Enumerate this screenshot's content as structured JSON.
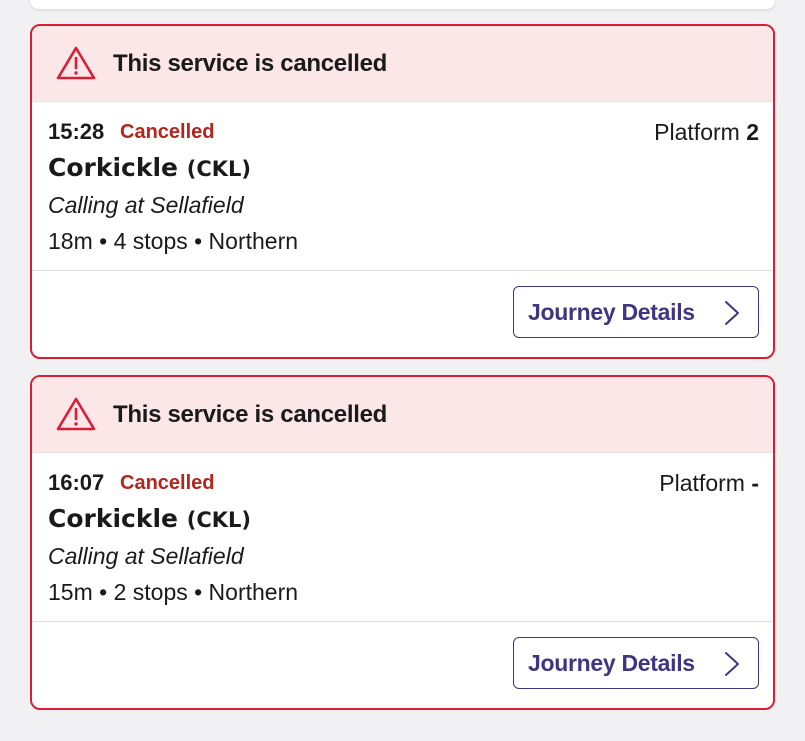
{
  "colors": {
    "alert_border": "#d81e34",
    "alert_bg": "#fce7e8",
    "status_red": "#b3261e",
    "button_accent": "#3f3580"
  },
  "services": [
    {
      "alert": "This service is cancelled",
      "time": "15:28",
      "status": "Cancelled",
      "platform_label": "Platform",
      "platform_value": "2",
      "destination": "Corkickle",
      "destination_code": "(CKL)",
      "calling": "Calling at Sellafield",
      "meta": "18m • 4 stops • Northern",
      "button_label": "Journey Details",
      "icons": [
        "warning-icon",
        "chevron-right-icon"
      ]
    },
    {
      "alert": "This service is cancelled",
      "time": "16:07",
      "status": "Cancelled",
      "platform_label": "Platform",
      "platform_value": "-",
      "destination": "Corkickle",
      "destination_code": "(CKL)",
      "calling": "Calling at Sellafield",
      "meta": "15m • 2 stops • Northern",
      "button_label": "Journey Details",
      "icons": [
        "warning-icon",
        "chevron-right-icon"
      ]
    }
  ]
}
